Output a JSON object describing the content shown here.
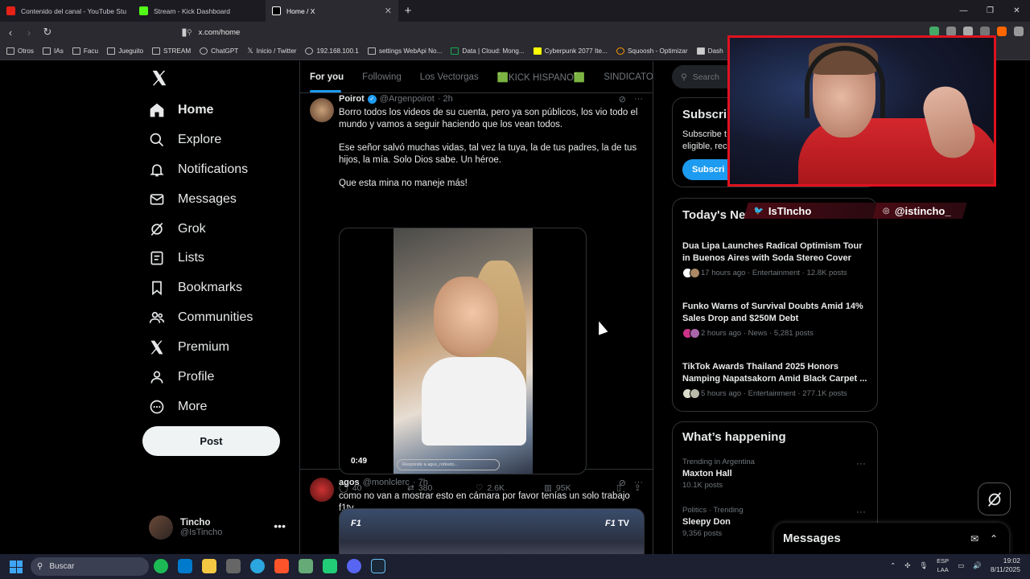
{
  "browser": {
    "tabs": [
      {
        "label": "Contenido del canal - YouTube Studio",
        "color": "#e62117"
      },
      {
        "label": "Stream - Kick Dashboard",
        "color": "#53fc18"
      },
      {
        "label": "Home / X",
        "color": "#ffffff"
      }
    ],
    "url": "x.com/home",
    "bookmarks": [
      "Otros",
      "IAs",
      "Facu",
      "Jueguito",
      "STREAM",
      "ChatGPT",
      "Inicio / Twitter",
      "192.168.100.1",
      "settings WebApi No...",
      "Data | Cloud: Mong...",
      "Cyberpunk 2077 Ite...",
      "Squoosh - Optimizar",
      "Dash"
    ]
  },
  "sidebar": {
    "items": [
      {
        "label": "Home",
        "icon": "home-icon"
      },
      {
        "label": "Explore",
        "icon": "search-icon"
      },
      {
        "label": "Notifications",
        "icon": "bell-icon"
      },
      {
        "label": "Messages",
        "icon": "envelope-icon"
      },
      {
        "label": "Grok",
        "icon": "grok-icon"
      },
      {
        "label": "Lists",
        "icon": "list-icon"
      },
      {
        "label": "Bookmarks",
        "icon": "bookmark-icon"
      },
      {
        "label": "Communities",
        "icon": "people-icon"
      },
      {
        "label": "Premium",
        "icon": "x-logo-icon"
      },
      {
        "label": "Profile",
        "icon": "person-icon"
      },
      {
        "label": "More",
        "icon": "more-circle-icon"
      }
    ],
    "post_label": "Post",
    "account": {
      "name": "Tincho",
      "handle": "@IsTincho"
    }
  },
  "feed": {
    "tabs": [
      "For you",
      "Following",
      "Los Vectorgas",
      "🟩KICK HISPANO🟩",
      "SINDICATO D"
    ],
    "tweets": [
      {
        "name": "Poirot",
        "handle": "@Argenpoirot",
        "time": "· 2h",
        "text1": "Borro todos los videos de su cuenta, pero ya son públicos, los vio todo el mundo y vamos a seguir haciendo que los vean todos.",
        "text2": "Ese señor salvó muchas vidas, tal vez la tuya, la de tus padres, la de tus hijos, la mía. Solo Dios sabe. Un héroe.",
        "text3": "Que esta mina no maneje más!",
        "video_duration": "0:49",
        "video_reply": "Responde a agus_robledo...",
        "replies": "40",
        "reposts": "380",
        "likes": "2.6K",
        "views": "95K"
      },
      {
        "name": "agos",
        "handle": "@monlclerc",
        "time": "· 7h",
        "text1": "como no van a mostrar esto en cámara por favor tenías un solo trabajo f1tv",
        "media_label": "TV"
      }
    ]
  },
  "right": {
    "search_placeholder": "Search",
    "subscribe": {
      "title": "Subscri",
      "text1": "Subscribe t",
      "text2": "eligible, rec",
      "button": "Subscri"
    },
    "news_title": "Today's New",
    "news": [
      {
        "title": "Dua Lipa Launches Radical Optimism Tour in Buenos Aires with Soda Stereo Cover",
        "meta": "17 hours ago · Entertainment · 12.8K posts"
      },
      {
        "title": "Funko Warns of Survival Doubts Amid 14% Sales Drop and $250M Debt",
        "meta": "2 hours ago · News · 5,281 posts"
      },
      {
        "title": "TikTok Awards Thailand 2025 Honors Namping Napatsakorn Amid Black Carpet ...",
        "meta": "5 hours ago · Entertainment · 277.1K posts"
      }
    ],
    "happening_title": "What’s happening",
    "trends": [
      {
        "meta": "Trending in Argentina",
        "name": "Maxton Hall",
        "count": "10.1K posts"
      },
      {
        "meta": "Politics · Trending",
        "name": "Sleepy Don",
        "count": "9,356 posts"
      }
    ],
    "messages_label": "Messages"
  },
  "overlay": {
    "twitter_handle": "IsTIncho",
    "instagram_handle": "@istincho_"
  },
  "taskbar": {
    "search": "Buscar",
    "lang1": "ESP",
    "lang2": "LAA",
    "time": "19:02",
    "date": "8/11/2025"
  }
}
